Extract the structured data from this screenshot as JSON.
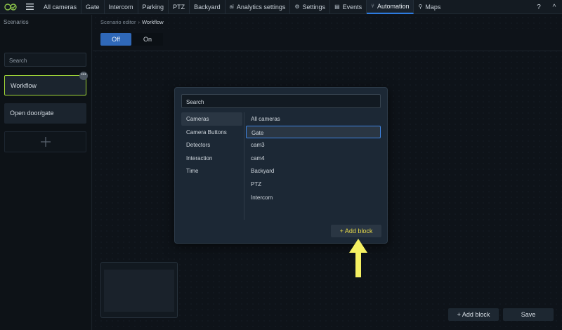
{
  "nav": {
    "tabs": [
      {
        "label": "All cameras",
        "icon": ""
      },
      {
        "label": "Gate",
        "icon": ""
      },
      {
        "label": "Intercom",
        "icon": ""
      },
      {
        "label": "Parking",
        "icon": ""
      },
      {
        "label": "PTZ",
        "icon": ""
      },
      {
        "label": "Backyard",
        "icon": ""
      },
      {
        "label": "Analytics settings",
        "icon": "analytics-icon"
      },
      {
        "label": "Settings",
        "icon": "gear-icon"
      },
      {
        "label": "Events",
        "icon": "events-icon"
      },
      {
        "label": "Automation",
        "icon": "automation-icon"
      },
      {
        "label": "Maps",
        "icon": "map-icon"
      }
    ],
    "active_tab": "Automation",
    "help": "?",
    "collapse": "^"
  },
  "sidebar": {
    "title": "Scenarios",
    "search_placeholder": "Search",
    "items": [
      {
        "label": "Workflow"
      },
      {
        "label": "Open door/gate"
      }
    ],
    "more": "•••"
  },
  "breadcrumb": {
    "parent": "Scenario editor",
    "separator": "›",
    "current": "Workflow"
  },
  "toggle": {
    "off": "Off",
    "on": "On",
    "selected": "Off"
  },
  "modal": {
    "search_placeholder": "Search",
    "categories": [
      "Cameras",
      "Camera Buttons",
      "Detectors",
      "Interaction",
      "Time"
    ],
    "active_category": "Cameras",
    "options": [
      "All cameras",
      "Gate",
      "cam3",
      "cam4",
      "Backyard",
      "PTZ",
      "Intercom"
    ],
    "selected_option": "Gate",
    "add_label": "+ Add block"
  },
  "footer": {
    "add_label": "+ Add block",
    "save_label": "Save"
  },
  "colors": {
    "accent": "#2f68b8",
    "selection": "#9fd337",
    "highlight_arrow": "#f5f062"
  }
}
